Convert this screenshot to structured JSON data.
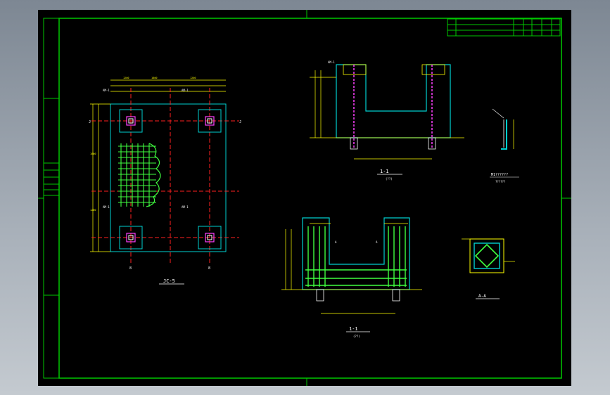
{
  "colors": {
    "background": "#000000",
    "border": "#00c800",
    "dim": "#ffff00",
    "structure": "#00d0d0",
    "grid": "#ff2020",
    "rebar": "#40ff40",
    "white": "#ffffff",
    "magenta": "#ff40ff"
  },
  "labels": {
    "plan_title": "JC-5",
    "section_top": "1-1",
    "section_top_sub": "(??)",
    "section_bottom": "1-1",
    "section_bottom_sub": "(??)",
    "detail_title": "A-A",
    "detail_note": "M1??????",
    "detail_note2": "??????",
    "anchor_mark": "AM-1",
    "side_mark_a": "A",
    "side_mark_b": "A",
    "grid_8a": "8",
    "grid_8b": "8",
    "grid_l": "J",
    "grid_r": "J"
  }
}
